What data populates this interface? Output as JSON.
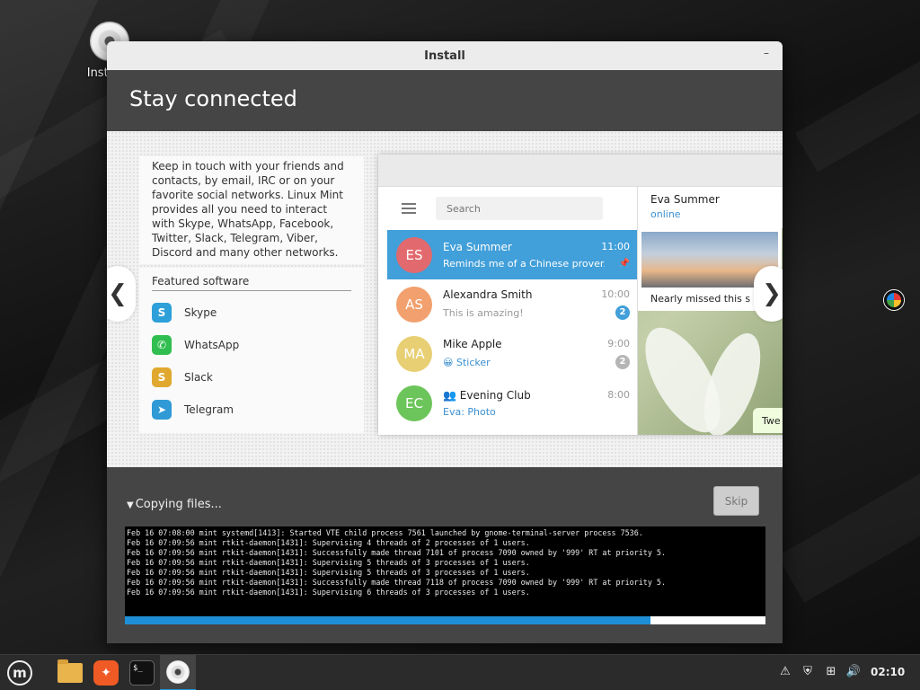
{
  "desktop": {
    "icon_label": "Install L"
  },
  "window": {
    "title": "Install",
    "minimize": "–",
    "header": "Stay connected"
  },
  "slide": {
    "description": "Keep in touch with your friends and contacts, by email, IRC or on your favorite social networks. Linux Mint provides all you need to interact with Skype, WhatsApp, Facebook, Twitter, Slack, Telegram, Viber, Discord and many other networks.",
    "featured_title": "Featured software",
    "apps": [
      {
        "name": "Skype",
        "icon": "skype-icon",
        "glyph": "S",
        "color": "#2d9fd9"
      },
      {
        "name": "WhatsApp",
        "icon": "whatsapp-icon",
        "glyph": "✆",
        "color": "#2fbe4f"
      },
      {
        "name": "Slack",
        "icon": "slack-icon",
        "glyph": "S",
        "color": "#e0a82e"
      },
      {
        "name": "Telegram",
        "icon": "telegram-icon",
        "glyph": "➤",
        "color": "#2f9ad6"
      }
    ],
    "prev_arrow": "❮",
    "next_arrow": "❯"
  },
  "telegram": {
    "search_placeholder": "Search",
    "chats": [
      {
        "initials": "ES",
        "name": "Eva Summer",
        "time": "11:00",
        "preview": "Reminds me of a Chinese prover...",
        "color": "#e26a6e",
        "badge": "📌"
      },
      {
        "initials": "AS",
        "name": "Alexandra Smith",
        "time": "10:00",
        "preview": "This is amazing!",
        "color": "#f2a06d",
        "badge": "2"
      },
      {
        "initials": "MA",
        "name": "Mike Apple",
        "time": "9:00",
        "preview": "😀 Sticker",
        "color": "#e8cf73",
        "badge": "2"
      },
      {
        "initials": "EC",
        "name": "👥 Evening Club",
        "time": "8:00",
        "preview": "Eva: Photo",
        "color": "#6cc55a",
        "badge": ""
      }
    ],
    "conversation": {
      "name": "Eva Summer",
      "status": "online",
      "photo_caption": "Nearly missed this s",
      "bubble": "Twe"
    }
  },
  "progress": {
    "status": "Copying files...",
    "skip_label": "Skip",
    "fraction": 0.82,
    "log": [
      "Feb 16 07:08:00 mint systemd[1413]: Started VTE child process 7561 launched by gnome-terminal-server process 7536.",
      "Feb 16 07:09:56 mint rtkit-daemon[1431]: Supervising 4 threads of 2 processes of 1 users.",
      "Feb 16 07:09:56 mint rtkit-daemon[1431]: Successfully made thread 7101 of process 7090 owned by '999' RT at priority 5.",
      "Feb 16 07:09:56 mint rtkit-daemon[1431]: Supervising 5 threads of 3 processes of 1 users.",
      "Feb 16 07:09:56 mint rtkit-daemon[1431]: Supervising 5 threads of 3 processes of 1 users.",
      "Feb 16 07:09:56 mint rtkit-daemon[1431]: Successfully made thread 7118 of process 7090 owned by '999' RT at priority 5.",
      "Feb 16 07:09:56 mint rtkit-daemon[1431]: Supervising 6 threads of 3 processes of 1 users."
    ]
  },
  "taskbar": {
    "mint_logo": "m",
    "terminal_prompt": "$_",
    "clock": "02:10"
  },
  "colors": {
    "accent": "#1e8fd6",
    "telegram_active": "#419fd9"
  }
}
